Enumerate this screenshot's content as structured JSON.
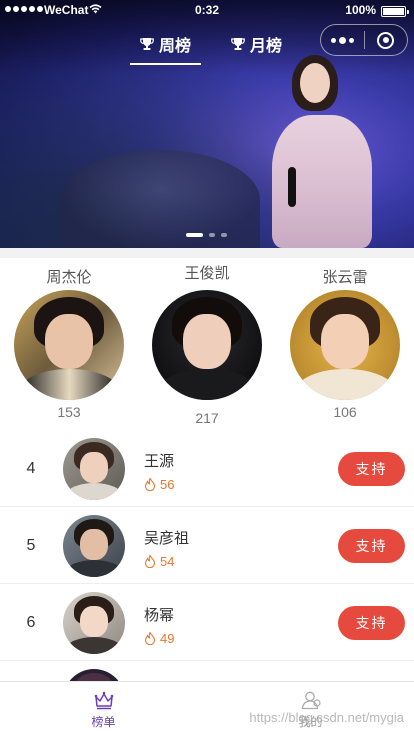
{
  "statusbar": {
    "carrier": "WeChat",
    "time": "0:32",
    "battery": "100%"
  },
  "tabs": [
    {
      "label": "周榜",
      "icon": "trophy-icon",
      "active": true
    },
    {
      "label": "月榜",
      "icon": "trophy-icon",
      "active": false
    }
  ],
  "banner": {
    "slides": 3,
    "active_slide": 1
  },
  "top3": [
    {
      "name": "周杰伦",
      "score": "153"
    },
    {
      "name": "王俊凯",
      "score": "217"
    },
    {
      "name": "张云雷",
      "score": "106"
    }
  ],
  "list": [
    {
      "rank": "4",
      "name": "王源",
      "heat": "56",
      "button": "支持"
    },
    {
      "rank": "5",
      "name": "吴彦祖",
      "heat": "54",
      "button": "支持"
    },
    {
      "rank": "6",
      "name": "杨幂",
      "heat": "49",
      "button": "支持"
    }
  ],
  "bottomnav": [
    {
      "label": "榜单",
      "icon": "crown-icon",
      "active": true
    },
    {
      "label": "我的",
      "icon": "user-icon",
      "active": false
    }
  ],
  "watermark": "https://blog.csdn.net/mygia",
  "colors": {
    "accent": "#6b3fb3",
    "support": "#e64a3e",
    "heat": "#e8762c"
  }
}
